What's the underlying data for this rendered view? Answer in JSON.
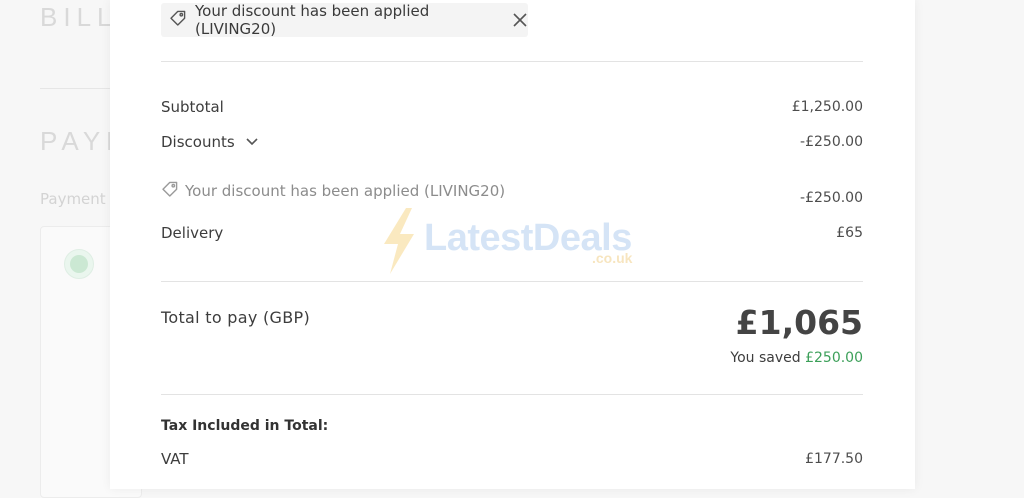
{
  "background": {
    "billing_heading": "BILL",
    "payment_heading": "PAYM",
    "payment_label": "Payment"
  },
  "chip": {
    "text": "Your discount has been applied (LIVING20)"
  },
  "summary": {
    "subtotal_label": "Subtotal",
    "subtotal_value": "£1,250.00",
    "discounts_label": "Discounts",
    "discounts_value": "-£250.00",
    "applied_text": "Your discount has been applied (LIVING20)",
    "applied_value": "-£250.00",
    "delivery_label": "Delivery",
    "delivery_value": "£65"
  },
  "total": {
    "label": "Total to pay (GBP)",
    "amount": "£1,065",
    "saved_prefix": "You saved",
    "saved_amount": "£250.00"
  },
  "tax": {
    "title": "Tax Included in Total:",
    "vat_label": "VAT",
    "vat_value": "£177.50"
  },
  "watermark": {
    "text": "LatestDeals",
    "sub": ".co.uk"
  },
  "colors": {
    "saved_green": "#3da05a"
  }
}
